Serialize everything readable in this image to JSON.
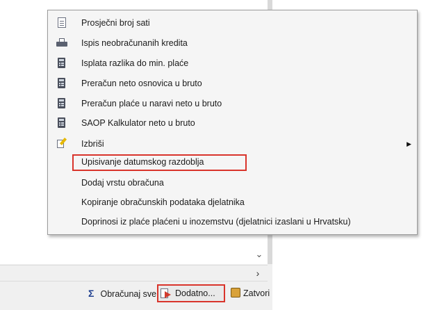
{
  "menu": {
    "items": [
      {
        "label": "Prosječni broj sati",
        "icon": "document-icon"
      },
      {
        "label": "Ispis neobračunanih kredita",
        "icon": "printer-icon"
      },
      {
        "label": "Isplata razlika do min. plaće",
        "icon": "calculator-icon"
      },
      {
        "label": "Preračun neto osnovica u bruto",
        "icon": "calculator-icon"
      },
      {
        "label": "Preračun plaće u naravi neto u bruto",
        "icon": "calculator-icon"
      },
      {
        "label": "SAOP Kalkulator neto u bruto",
        "icon": "calculator-icon"
      },
      {
        "label": "Izbriši",
        "icon": "edit-icon",
        "submenu": true
      },
      {
        "label": "Upisivanje datumskog razdoblja",
        "highlighted": true
      },
      {
        "label": "Dodaj vrstu obračuna"
      },
      {
        "label": "Kopiranje obračunskih podataka djelatnika"
      },
      {
        "label": "Doprinosi iz plaće plaćeni u inozemstvu (djelatnici izaslani u Hrvatsku)"
      }
    ]
  },
  "toolbar": {
    "obracunaj_label": "Obračunaj sve",
    "dodatno_label": "Dodatno...",
    "zatvori_label": "Zatvori"
  },
  "colors": {
    "highlight_border": "#d9342b",
    "menu_background": "#f5f5f5"
  }
}
